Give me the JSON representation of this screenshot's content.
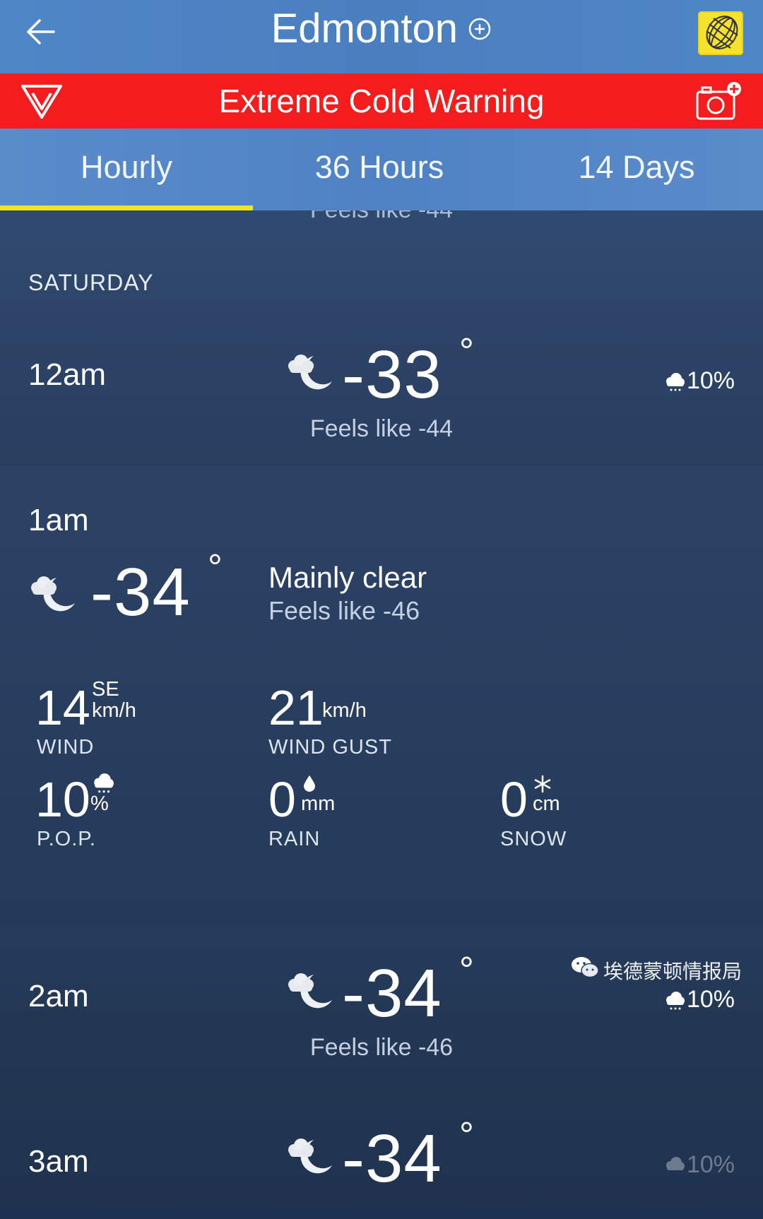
{
  "header": {
    "city": "Edmonton",
    "back_icon": "arrow-left-icon",
    "add_icon": "circle-plus-icon",
    "logo_icon": "globe-logo-icon"
  },
  "warning": {
    "text": "Extreme Cold Warning",
    "color": "#f41c1c"
  },
  "tabs": [
    {
      "label": "Hourly",
      "active": true
    },
    {
      "label": "36 Hours",
      "active": false
    },
    {
      "label": "14 Days",
      "active": false
    }
  ],
  "accent_color": "#f2e41c",
  "prev_row": {
    "feels": "Feels like -44"
  },
  "day": "SATURDAY",
  "hours": [
    {
      "time": "12am",
      "temp": "-33",
      "deg": "°",
      "feels": "Feels like -44",
      "pop": "10%",
      "icon": "moon-cloud-icon"
    },
    {
      "time": "1am",
      "temp": "-34",
      "deg": "°",
      "condition": "Mainly clear",
      "feels": "Feels like -46",
      "icon": "moon-cloud-icon",
      "wind": {
        "value": "14",
        "dir": "SE",
        "unit": "km/h",
        "label": "WIND"
      },
      "gust": {
        "value": "21",
        "unit": "km/h",
        "label": "WIND GUST"
      },
      "pop": {
        "value": "10",
        "unit": "%",
        "label": "P.O.P."
      },
      "rain": {
        "value": "0",
        "unit": "mm",
        "label": "RAIN"
      },
      "snow": {
        "value": "0",
        "unit": "cm",
        "label": "SNOW"
      }
    },
    {
      "time": "2am",
      "temp": "-34",
      "deg": "°",
      "feels": "Feels like -46",
      "pop": "10%",
      "icon": "moon-cloud-icon"
    },
    {
      "time": "3am",
      "temp": "-34",
      "deg": "°",
      "pop": "10%",
      "icon": "moon-cloud-icon"
    }
  ],
  "watermark": {
    "text": "埃德蒙顿情报局",
    "icon": "wechat-icon"
  }
}
